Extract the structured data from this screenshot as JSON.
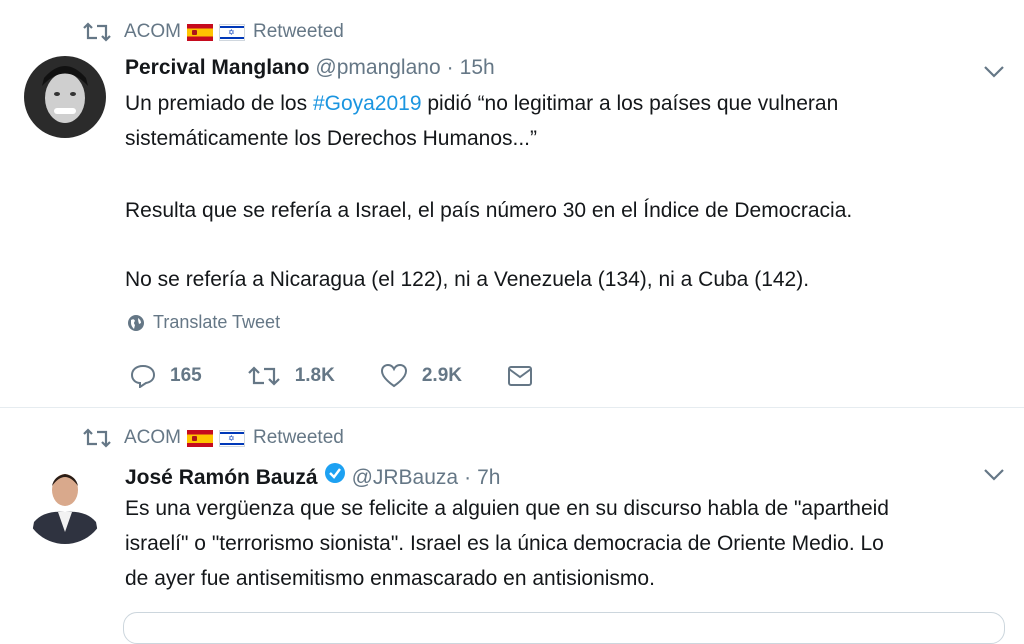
{
  "tweets": [
    {
      "retweeter": "ACOM",
      "retweet_label": "Retweeted",
      "author_name": "Percival Manglano",
      "handle": "@pmanglano",
      "dot": "·",
      "time": "15h",
      "text_lines": [
        "Un premiado de los ",
        "#Goya2019",
        " pidió “no legitimar a los países que vulneran",
        "sistemáticamente los Derechos Humanos...”",
        "Resulta que se refería a Israel, el país número 30 en el Índice de Democracia.",
        "No se refería a Nicaragua (el 122), ni a Venezuela (134), ni a Cuba (142)."
      ],
      "translate_label": "Translate Tweet",
      "replies": "165",
      "retweets": "1.8K",
      "likes": "2.9K"
    },
    {
      "retweeter": "ACOM",
      "retweet_label": "Retweeted",
      "author_name": "José Ramón Bauzá",
      "handle": "@JRBauza",
      "dot": "·",
      "time": "7h",
      "text_lines": [
        "Es una vergüenza que se felicite a alguien que en su discurso habla de \"apartheid",
        "israelí\" o \"terrorismo sionista\". Israel es la única democracia de Oriente Medio. Lo",
        "de ayer fue antisemitismo enmascarado en antisionismo."
      ]
    }
  ],
  "colors": {
    "link": "#1b95e0",
    "muted": "#657786",
    "text": "#14171a",
    "verified": "#1da1f2"
  },
  "icons": [
    "retweet-icon",
    "spain-flag-icon",
    "israel-flag-icon",
    "chevron-down-icon",
    "globe-icon",
    "reply-icon",
    "heart-icon",
    "mail-icon",
    "verified-icon"
  ]
}
